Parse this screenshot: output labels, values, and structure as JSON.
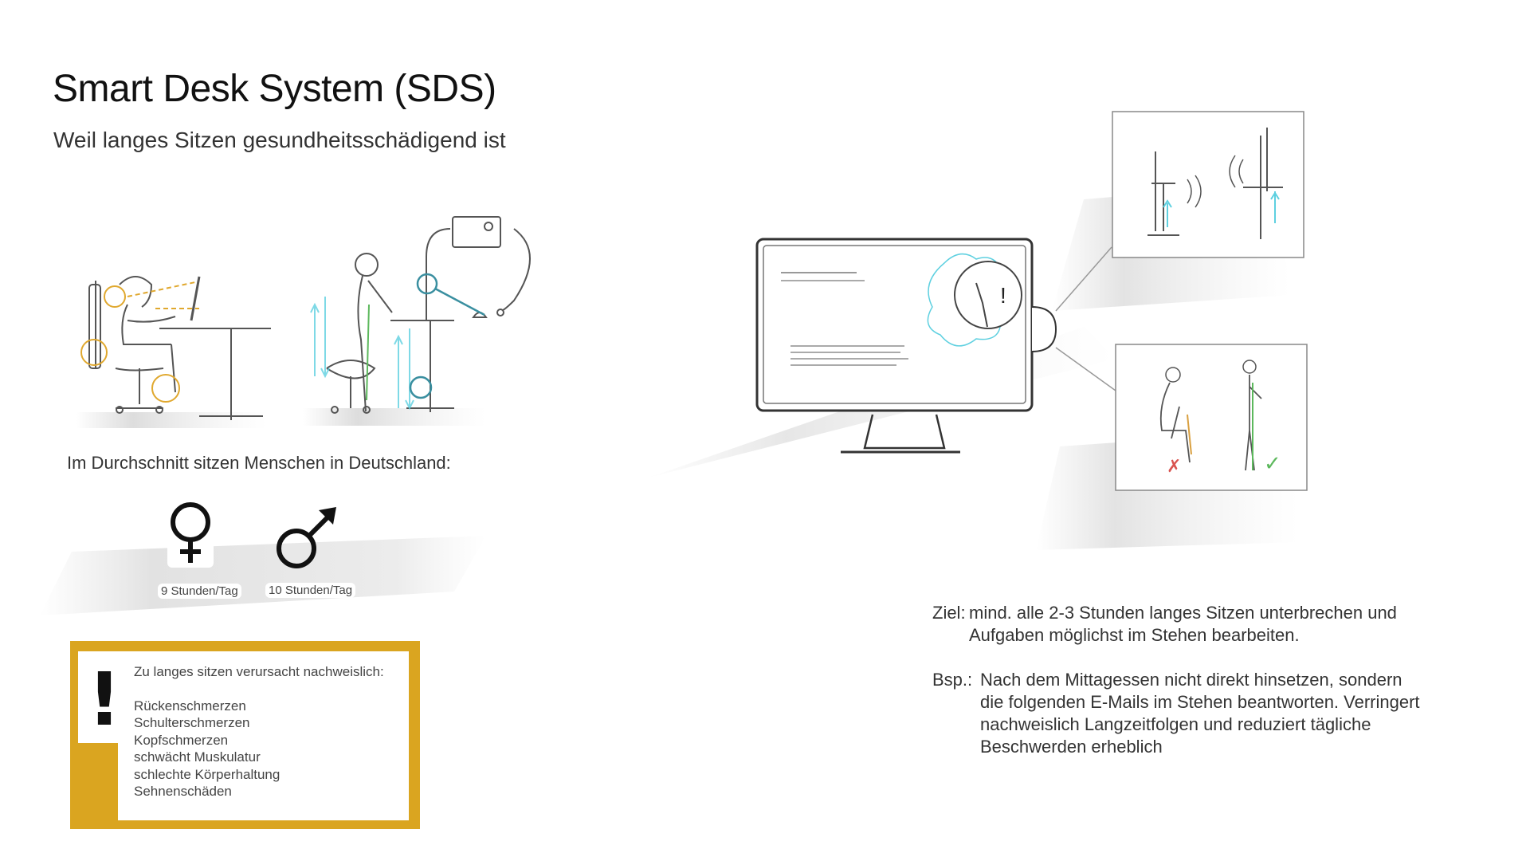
{
  "header": {
    "title": "Smart Desk System (SDS)",
    "subtitle": "Weil langes Sitzen gesundheitsschädigend ist"
  },
  "statistics": {
    "intro": "Im Durchschnitt sitzen Menschen in Deutschland:",
    "female": {
      "symbol": "♀",
      "label": "9 Stunden/Tag"
    },
    "male": {
      "symbol": "♂",
      "label": "10 Stunden/Tag"
    }
  },
  "warning": {
    "icon": "!",
    "heading": "Zu langes sitzen verursacht nachweislich:",
    "items": [
      "Rückenschmerzen",
      "Schulterschmerzen",
      "Kopfschmerzen",
      "schwächt Muskulatur",
      "schlechte Körperhaltung",
      "Sehnenschäden"
    ],
    "accent_color": "#daa520"
  },
  "goal": {
    "label": "Ziel:",
    "text": "mind. alle 2-3 Stunden langes Sitzen unterbrechen und Aufgaben möglichst im Stehen bearbeiten."
  },
  "example": {
    "label": "Bsp.:",
    "text": "Nach dem Mittagessen nicht direkt hinsetzen, sondern die folgenden E-Mails im Stehen beantworten. Verringert nachweislich Langzeitfolgen und reduziert tägliche Beschwerden erheblich"
  },
  "illustrations": {
    "left": "sitting-standing-desk-sketch",
    "right": "monitor-notification-sketch",
    "posture_marks": {
      "wrong": "✗",
      "right": "✓"
    },
    "colors": {
      "wrong": "#d9534f",
      "right": "#5cb85c",
      "highlight": "#e0a82e",
      "cyan": "#5ed0e0",
      "teal": "#3a8fa0"
    }
  }
}
